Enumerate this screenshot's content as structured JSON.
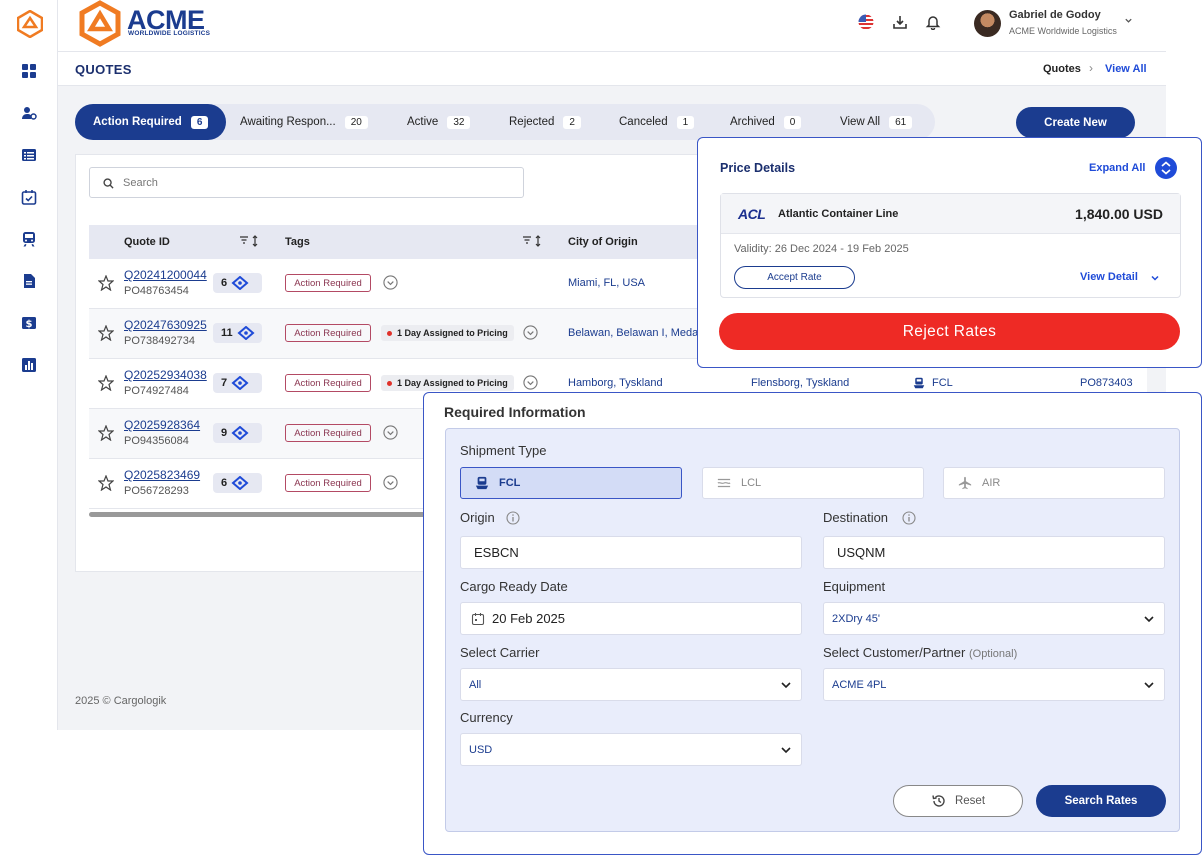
{
  "brand": {
    "name": "ACME",
    "tagline": "WORLDWIDE LOGISTICS"
  },
  "colors": {
    "primary": "#1b3c8f",
    "link": "#1f4bd8",
    "danger": "#ee2a25",
    "accent": "#f07b22"
  },
  "user": {
    "name": "Gabriel de Godoy",
    "org": "ACME Worldwide Logistics"
  },
  "header": {
    "icons": [
      "us-flag-icon",
      "download-icon",
      "bell-icon"
    ]
  },
  "sidebar": {
    "icons": [
      "dashboard-icon",
      "user-settings-icon",
      "list-icon",
      "calendar-check-icon",
      "train-icon",
      "document-icon",
      "dollar-icon",
      "chart-icon"
    ]
  },
  "page": {
    "title": "QUOTES",
    "breadcrumb": {
      "current": "Quotes",
      "sep": "›",
      "link": "View All"
    }
  },
  "tabs": [
    {
      "label": "Action Required",
      "count": "6"
    },
    {
      "label": "Awaiting Respon...",
      "count": "20"
    },
    {
      "label": "Active",
      "count": "32"
    },
    {
      "label": "Rejected",
      "count": "2"
    },
    {
      "label": "Canceled",
      "count": "1"
    },
    {
      "label": "Archived",
      "count": "0"
    },
    {
      "label": "View All",
      "count": "61"
    }
  ],
  "create_button": "Create New",
  "search": {
    "placeholder": "Search"
  },
  "table": {
    "headers": {
      "quote_id": "Quote ID",
      "tags": "Tags",
      "origin": "City of Origin"
    },
    "rows": [
      {
        "id": "Q20241200044",
        "po": "PO48763454",
        "msgs": "6",
        "tag": "Action Required",
        "extra": "",
        "city": "Miami, FL, USA",
        "dest": "",
        "mode": "",
        "ref": ""
      },
      {
        "id": "Q20247630925",
        "po": "PO738492734",
        "msgs": "11",
        "tag": "Action Required",
        "extra": "1 Day Assigned to Pricing",
        "city": "Belawan, Belawan I, Meda",
        "dest": "",
        "mode": "",
        "ref": ""
      },
      {
        "id": "Q20252934038",
        "po": "PO74927484",
        "msgs": "7",
        "tag": "Action Required",
        "extra": "1 Day Assigned to Pricing",
        "city": "Hamborg, Tyskland",
        "dest": "Flensborg, Tyskland",
        "mode": "FCL",
        "ref": "PO873403"
      },
      {
        "id": "Q2025928364",
        "po": "PO94356084",
        "msgs": "9",
        "tag": "Action Required",
        "extra": "",
        "city": "",
        "dest": "",
        "mode": "",
        "ref": ""
      },
      {
        "id": "Q2025823469",
        "po": "PO56728293",
        "msgs": "6",
        "tag": "Action Required",
        "extra": "",
        "city": "",
        "dest": "",
        "mode": "",
        "ref": ""
      }
    ]
  },
  "footer": "2025 © Cargologik",
  "price_details": {
    "title": "Price Details",
    "expand_label": "Expand All",
    "carrier": {
      "logo": "ACL",
      "name": "Atlantic Container Line",
      "price": "1,840.00 USD",
      "validity": "Validity: 26 Dec 2024 - 19 Feb 2025"
    },
    "accept_label": "Accept Rate",
    "view_detail_label": "View Detail",
    "reject_label": "Reject  Rates"
  },
  "required_info": {
    "title": "Required Information",
    "shipment_type_label": "Shipment Type",
    "shipment_types": [
      {
        "label": "FCL",
        "icon": "ship-icon",
        "selected": true
      },
      {
        "label": "LCL",
        "icon": "waves-icon",
        "selected": false
      },
      {
        "label": "AIR",
        "icon": "plane-icon",
        "selected": false
      }
    ],
    "origin": {
      "label": "Origin",
      "value": "ESBCN"
    },
    "destination": {
      "label": "Destination",
      "value": "USQNM"
    },
    "cargo_ready_date": {
      "label": "Cargo Ready Date",
      "value": "20 Feb 2025"
    },
    "equipment": {
      "label": "Equipment",
      "value": "2XDry 45'"
    },
    "carrier": {
      "label": "Select Carrier",
      "value": "All"
    },
    "customer": {
      "label": "Select Customer/Partner",
      "optional": "(Optional)",
      "value": "ACME 4PL"
    },
    "currency": {
      "label": "Currency",
      "value": "USD"
    },
    "reset_label": "Reset",
    "search_label": "Search Rates"
  }
}
